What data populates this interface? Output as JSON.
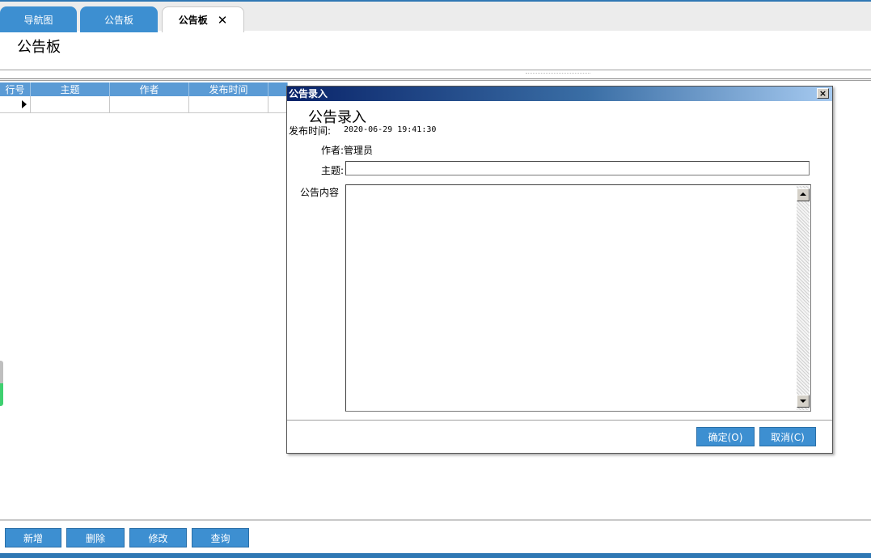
{
  "tabs": [
    {
      "label": "导航图"
    },
    {
      "label": "公告板"
    },
    {
      "label": "公告板",
      "close": "✕"
    }
  ],
  "page": {
    "title": "公告板"
  },
  "grid": {
    "columns": [
      "行号",
      "主题",
      "作者",
      "发布时间"
    ]
  },
  "toolbar": {
    "add": "新增",
    "delete": "删除",
    "edit": "修改",
    "query": "查询"
  },
  "dialog": {
    "title": "公告录入",
    "close": "×",
    "heading": "公告录入",
    "publish_time_label": "发布时间:",
    "publish_time_value": "2020-06-29 19:41:30",
    "author_label": "作者:",
    "author_value": "管理员",
    "subject_label": "主题:",
    "subject_value": "",
    "content_label": "公告内容",
    "content_value": "",
    "ok": "确定(O)",
    "cancel": "取消(C)"
  },
  "colors": {
    "tab_blue": "#3d8fd1",
    "header_blue": "#5b9bd5",
    "title_gradient_start": "#0a246a",
    "title_gradient_end": "#a6caf0"
  }
}
